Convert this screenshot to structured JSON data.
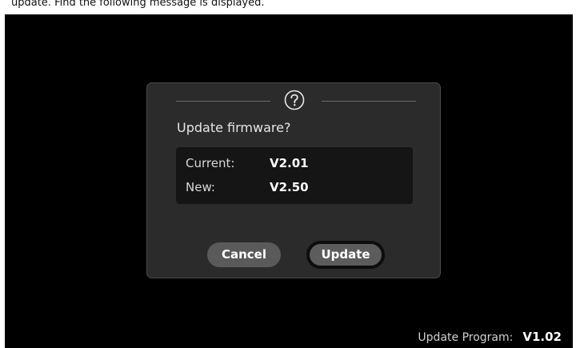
{
  "top_caption": "update. Find the following message is displayed.",
  "dialog": {
    "icon": "question-circle-icon",
    "title": "Update firmware?",
    "rows": [
      {
        "label": "Current:",
        "value": "V2.01"
      },
      {
        "label": "New:",
        "value": "V2.50"
      }
    ],
    "cancel_label": "Cancel",
    "update_label": "Update"
  },
  "footer": {
    "label": "Update Program:",
    "value": "V1.02"
  },
  "colors": {
    "screen_bg": "#000000",
    "dialog_bg": "#2b2b2c",
    "info_bg": "#151515",
    "button_bg": "#5a5a5a"
  }
}
